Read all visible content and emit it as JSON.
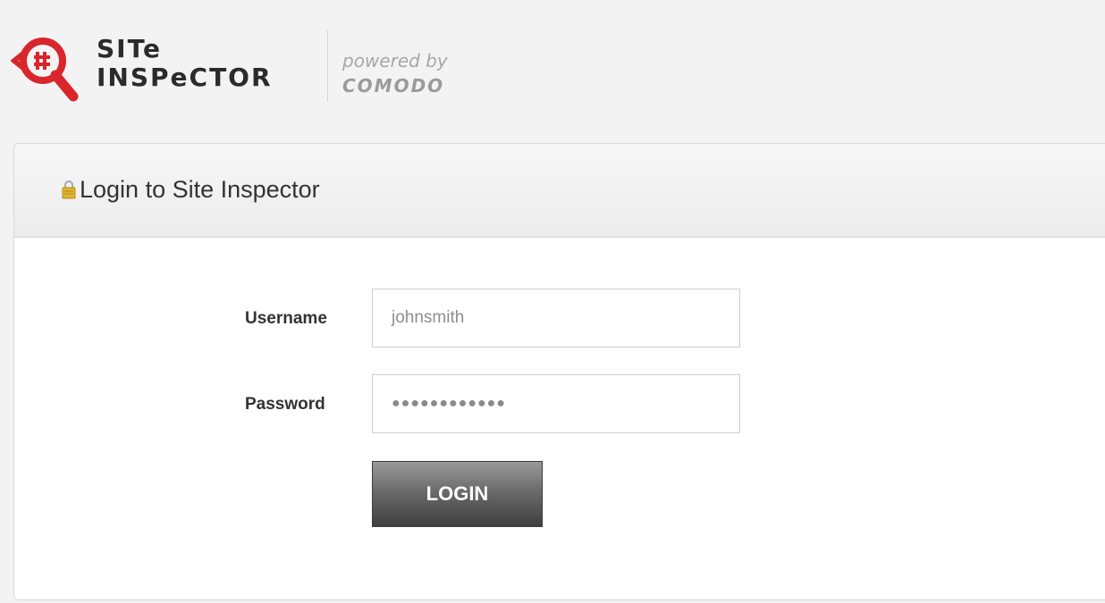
{
  "header": {
    "logo_line1": "SITe",
    "logo_line2": "INSPeCTOR",
    "powered_by": "powered by",
    "brand": "COMODO"
  },
  "panel": {
    "title": "Login to Site Inspector",
    "icon": "lock-icon"
  },
  "form": {
    "username_label": "Username",
    "username_value": "johnsmith",
    "password_label": "Password",
    "password_value": "●●●●●●●●●●●●",
    "login_label": "LOGIN"
  },
  "colors": {
    "accent": "#d9262c",
    "text": "#333333",
    "button": "#5a5a5a"
  }
}
